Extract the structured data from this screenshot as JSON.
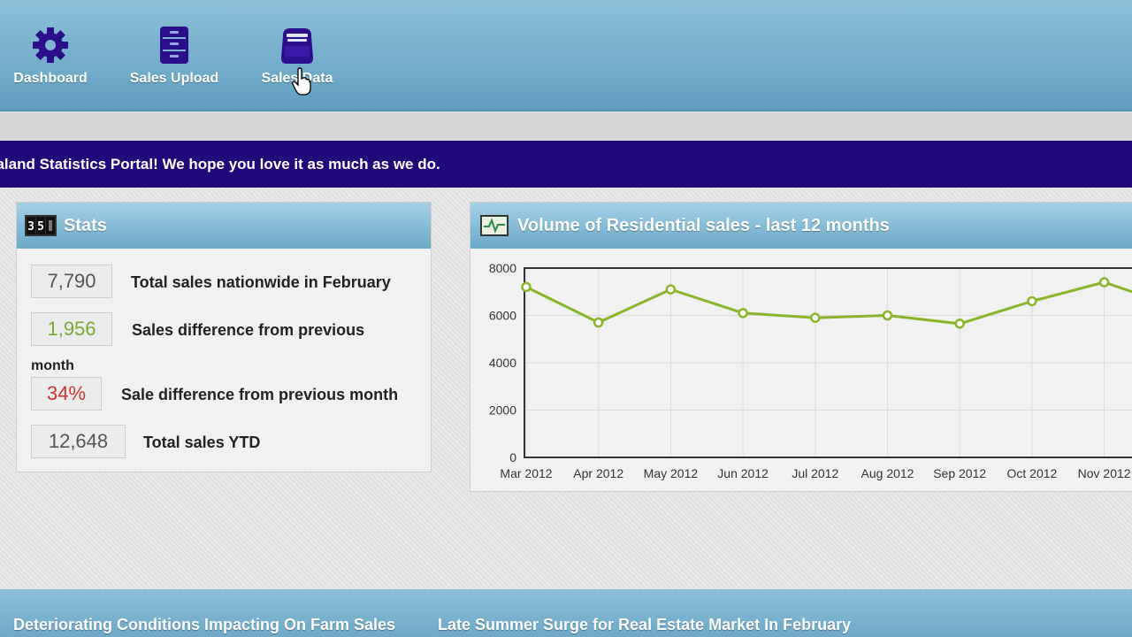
{
  "nav": {
    "items": [
      {
        "label": "Dashboard",
        "icon": "gear-icon"
      },
      {
        "label": "Sales Upload",
        "icon": "file-cabinet-icon"
      },
      {
        "label": "Sales Data",
        "icon": "inbox-tray-icon"
      }
    ]
  },
  "banner": {
    "text": "ealand Statistics Portal! We hope you love it as much as we do."
  },
  "stats": {
    "title": "Stats",
    "icon_text": "35",
    "rows": [
      {
        "value": "7,790",
        "label": "Total sales nationwide in February",
        "color": "#555555"
      },
      {
        "value": "1,956",
        "label": "Sales difference from previous",
        "label_cont": "month",
        "color": "#7aa832"
      },
      {
        "value": "34%",
        "label": "Sale difference from previous month",
        "color": "#cc3333"
      },
      {
        "value": "12,648",
        "label": "Total sales YTD",
        "color": "#555555"
      }
    ]
  },
  "chart_panel": {
    "title": "Volume of Residential sales - last 12 months",
    "icon": "heartbeat-monitor-icon"
  },
  "chart_data": {
    "type": "line",
    "title": "Volume of Residential sales - last 12 months",
    "categories": [
      "Mar 2012",
      "Apr 2012",
      "May 2012",
      "Jun 2012",
      "Jul 2012",
      "Aug 2012",
      "Sep 2012",
      "Oct 2012",
      "Nov 2012"
    ],
    "series": [
      {
        "values": [
          7200,
          5700,
          7100,
          6100,
          5900,
          6000,
          5650,
          6600,
          7400
        ],
        "color": "#8ab42a"
      }
    ],
    "yticks": [
      "0",
      "2000",
      "4000",
      "6000",
      "8000"
    ],
    "ylim": [
      0,
      8000
    ],
    "grid": true,
    "xlabel": "",
    "ylabel": ""
  },
  "news": [
    {
      "label": "Deteriorating Conditions Impacting On Farm Sales"
    },
    {
      "label": "Late Summer Surge for Real Estate Market In February"
    }
  ]
}
